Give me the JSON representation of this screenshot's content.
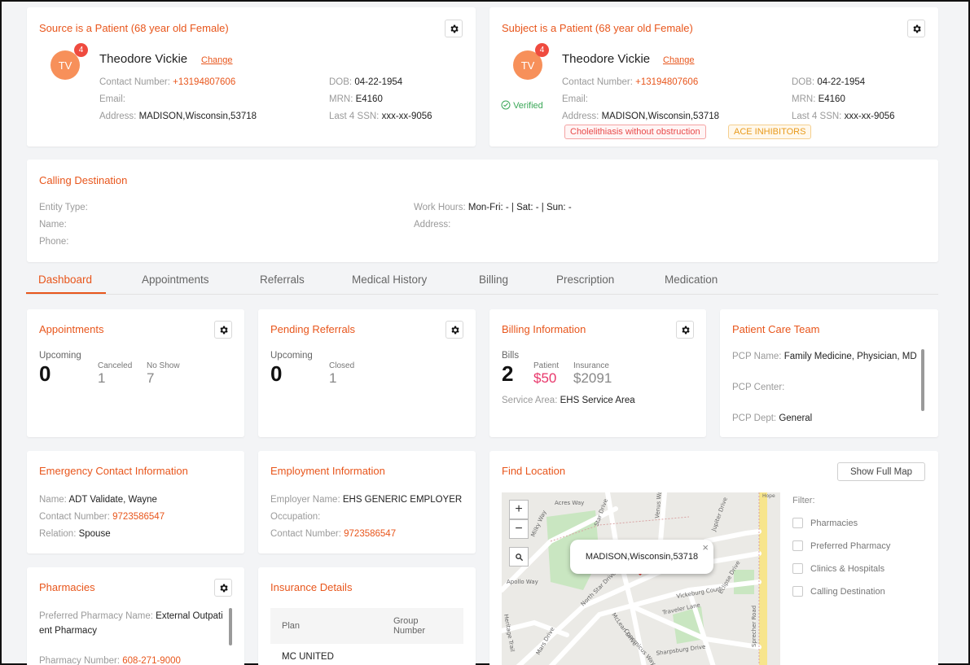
{
  "source": {
    "title": "Source is a Patient (68 year old Female)",
    "initials": "TV",
    "badge": "4",
    "name": "Theodore Vickie",
    "change_label": "Change",
    "contact_label": "Contact Number:",
    "contact_value": "+13194807606",
    "email_label": "Email:",
    "address_label": "Address:",
    "address_value": "MADISON,Wisconsin,53718",
    "dob_label": "DOB:",
    "dob_value": "04-22-1954",
    "mrn_label": "MRN:",
    "mrn_value": "E4160",
    "ssn_label": "Last 4 SSN:",
    "ssn_value": "xxx-xx-9056"
  },
  "subject": {
    "title": "Subject is a Patient (68 year old Female)",
    "initials": "TV",
    "badge": "4",
    "name": "Theodore Vickie",
    "change_label": "Change",
    "verified_label": "Verified",
    "contact_label": "Contact Number:",
    "contact_value": "+13194807606",
    "email_label": "Email:",
    "address_label": "Address:",
    "address_value": "MADISON,Wisconsin,53718",
    "dob_label": "DOB:",
    "dob_value": "04-22-1954",
    "mrn_label": "MRN:",
    "mrn_value": "E4160",
    "ssn_label": "Last 4 SSN:",
    "ssn_value": "xxx-xx-9056",
    "tags": [
      "Cholelithiasis without obstruction",
      "ACE INHIBITORS"
    ]
  },
  "calling": {
    "title": "Calling Destination",
    "entity_label": "Entity Type:",
    "name_label": "Name:",
    "phone_label": "Phone:",
    "work_label": "Work Hours:",
    "work_value": "Mon-Fri: - | Sat: - | Sun: -",
    "address_label": "Address:"
  },
  "tabs": [
    "Dashboard",
    "Appointments",
    "Referrals",
    "Medical History",
    "Billing",
    "Prescription",
    "Medication"
  ],
  "appointments": {
    "title": "Appointments",
    "upcoming_label": "Upcoming",
    "upcoming_value": "0",
    "canceled_label": "Canceled",
    "canceled_value": "1",
    "noshow_label": "No Show",
    "noshow_value": "7"
  },
  "referrals": {
    "title": "Pending Referrals",
    "upcoming_label": "Upcoming",
    "upcoming_value": "0",
    "closed_label": "Closed",
    "closed_value": "1"
  },
  "billing": {
    "title": "Billing Information",
    "bills_label": "Bills",
    "bills_value": "2",
    "patient_label": "Patient",
    "patient_value": "$50",
    "insurance_label": "Insurance",
    "insurance_value": "$2091",
    "service_label": "Service Area:",
    "service_value": "EHS Service Area"
  },
  "care_team": {
    "title": "Patient Care Team",
    "pcp_name_label": "PCP Name:",
    "pcp_name_value": "Family Medicine, Physician, MD",
    "pcp_center_label": "PCP Center:",
    "pcp_dept_label": "PCP Dept:",
    "pcp_dept_value": "General"
  },
  "emergency": {
    "title": "Emergency Contact Information",
    "name_label": "Name:",
    "name_value": "ADT Validate, Wayne",
    "contact_label": "Contact Number:",
    "contact_value": "9723586547",
    "relation_label": "Relation:",
    "relation_value": "Spouse"
  },
  "employment": {
    "title": "Employment Information",
    "employer_label": "Employer Name:",
    "employer_value": "EHS GENERIC EMPLOYER",
    "occupation_label": "Occupation:",
    "contact_label": "Contact Number:",
    "contact_value": "9723586547"
  },
  "location": {
    "title": "Find Location",
    "show_map_label": "Show Full Map",
    "filter_label": "Filter:",
    "filters": [
      "Pharmacies",
      "Preferred Pharmacy",
      "Clinics & Hospitals",
      "Calling Destination"
    ],
    "popup_text": "MADISON,Wisconsin,53718",
    "zoom_in": "+",
    "zoom_out": "−",
    "streets": [
      "Acres Way",
      "Star Drive",
      "Venus Way",
      "Jupiter Drive",
      "Hope",
      "Milky Way",
      "Apollo Way",
      "North Star Drive",
      "McLean Drive",
      "Vickeburg Court",
      "Traveler Lane",
      "Sprecher Road",
      "Sharpsburg Drive",
      "Copernicus Way",
      "Mars Drive",
      "Eclipse Drive",
      "Heritage Trail"
    ]
  },
  "pharmacies": {
    "title": "Pharmacies",
    "preferred_label": "Preferred Pharmacy Name:",
    "preferred_value_1": "External Outpati",
    "preferred_value_2": "ent Pharmacy",
    "number_label": "Pharmacy Number:",
    "number_value": "608-271-9000"
  },
  "insurance": {
    "title": "Insurance Details",
    "col_plan": "Plan",
    "col_group_1": "Group",
    "col_group_2": "Number",
    "row_plan": "MC UNITED"
  }
}
